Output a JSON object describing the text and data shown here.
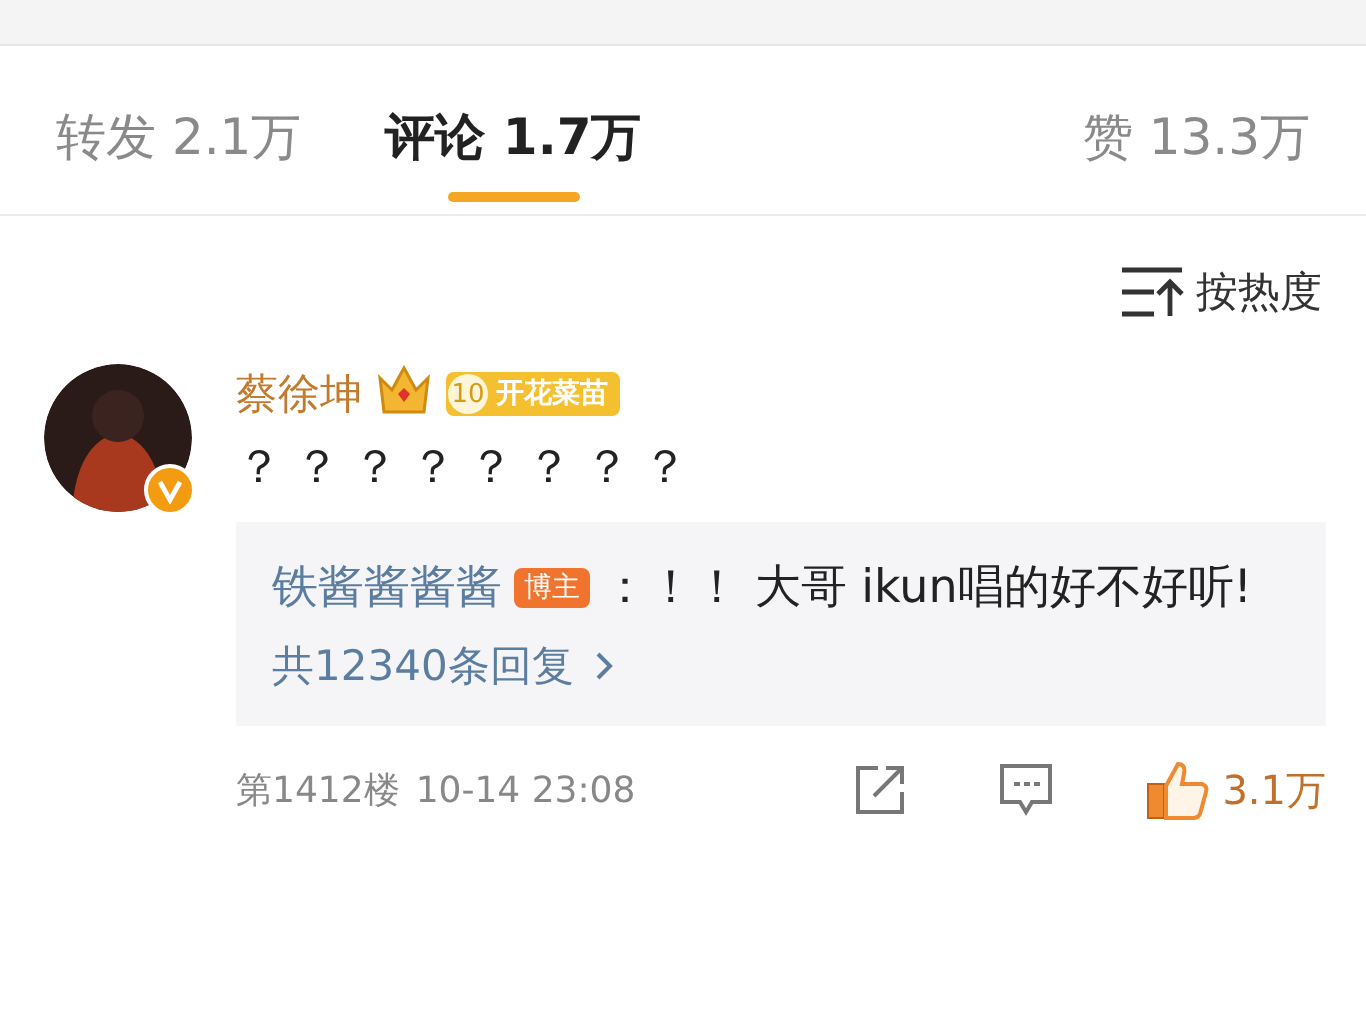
{
  "tabs": [
    {
      "label": "转发 2.1万",
      "selected": false
    },
    {
      "label": "评论 1.7万",
      "selected": true
    },
    {
      "label": "赞 13.3万",
      "selected": false
    }
  ],
  "sort": {
    "label": "按热度"
  },
  "comment": {
    "author": "蔡徐坤",
    "verified": true,
    "fan_badge": {
      "level": "10",
      "label": "开花菜苗"
    },
    "text": "？？？？？？？？",
    "reply_preview": {
      "author": "铁酱酱酱酱",
      "author_badge": "博主",
      "text": "：！！ 大哥 ikun唱的好不好听!",
      "more": "共12340条回复"
    },
    "floor": "第1412楼",
    "time": "10-14 23:08",
    "likes": "3.1万",
    "liked": true
  }
}
